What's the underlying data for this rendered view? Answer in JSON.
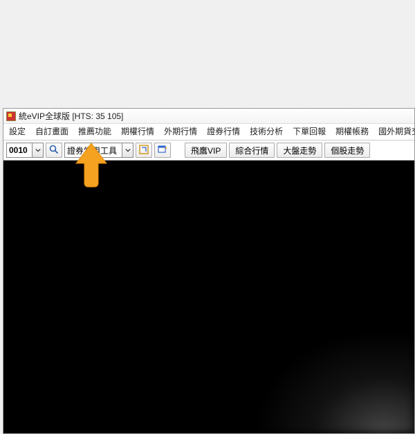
{
  "window": {
    "title": "統eVIP全球版  [HTS: 35 105]"
  },
  "menu": {
    "items": [
      "設定",
      "自訂畫面",
      "推薦功能",
      "期權行情",
      "外期行情",
      "證券行情",
      "技術分析",
      "下單回報",
      "期權帳務",
      "國外期貨交易帳務"
    ]
  },
  "toolbar": {
    "code_value": "0010",
    "tool_combo_value": "證券常用工具",
    "buttons": [
      "飛鷹VIP",
      "綜合行情",
      "大盤走勢",
      "個股走勢"
    ]
  }
}
